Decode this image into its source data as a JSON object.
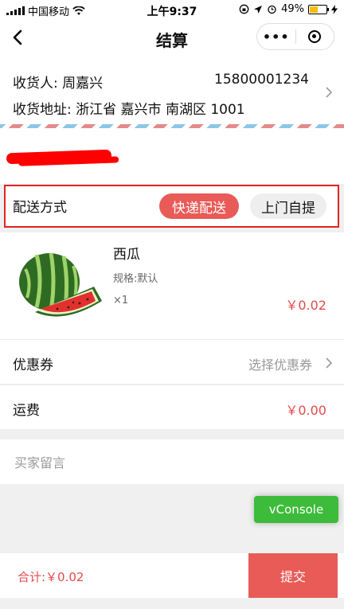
{
  "status_bar": {
    "carrier": "中国移动",
    "time": "上午9:37",
    "battery": "49%",
    "battery_level": 0.49
  },
  "nav": {
    "title": "结算",
    "more_label": "•••"
  },
  "address": {
    "recipient": "收货人: 周嘉兴",
    "phone": "15800001234",
    "address": "收货地址: 浙江省 嘉兴市 南湖区 1001"
  },
  "delivery": {
    "label": "配送方式",
    "options": [
      "快递配送",
      "上门自提"
    ],
    "selected": "快递配送"
  },
  "product": {
    "name": "西瓜",
    "spec": "规格:默认",
    "qty": "×1",
    "price": "￥0.02"
  },
  "coupon": {
    "label": "优惠券",
    "value": "选择优惠券"
  },
  "shipping": {
    "label": "运费",
    "value": "￥0.00"
  },
  "message": {
    "placeholder": "买家留言"
  },
  "vconsole": {
    "label": "vConsole"
  },
  "footer": {
    "total": "合计:￥0.02",
    "submit_label": "提交"
  },
  "colors": {
    "accent": "#e85b57",
    "price": "#e34a4a",
    "vconsole": "#3dbb3a"
  }
}
